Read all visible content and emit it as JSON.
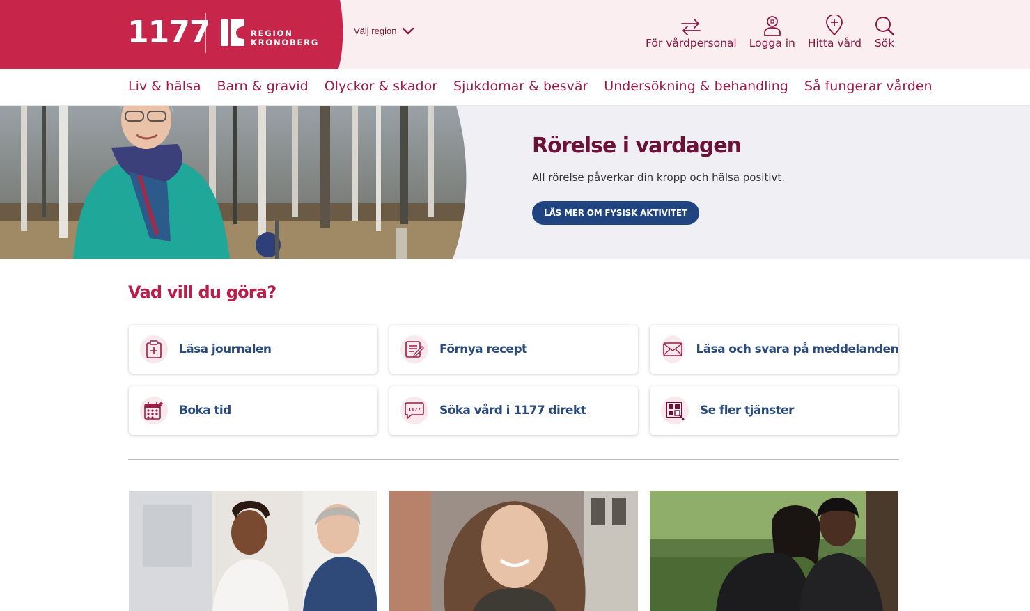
{
  "header": {
    "logo_text": "1177",
    "region_logo_text": [
      "REGION",
      "KRONOBERG"
    ],
    "region_select_label": "Välj region",
    "actions": [
      {
        "icon": "swap-arrows-icon",
        "label": "För vårdpersonal"
      },
      {
        "icon": "user-lock-icon",
        "label": "Logga in"
      },
      {
        "icon": "location-plus-icon",
        "label": "Hitta vård"
      },
      {
        "icon": "search-icon",
        "label": "Sök"
      }
    ]
  },
  "nav": {
    "items": [
      "Liv & hälsa",
      "Barn & gravid",
      "Olyckor & skador",
      "Sjukdomar & besvär",
      "Undersökning & behandling",
      "Så fungerar vården"
    ]
  },
  "hero": {
    "title": "Rörelse i vardagen",
    "text": "All rörelse påverkar din kropp och hälsa positivt.",
    "button": "LÄS MER OM FYSISK AKTIVITET"
  },
  "services": {
    "title": "Vad vill du göra?",
    "items": [
      {
        "icon": "medical-record-icon",
        "label": "Läsa journalen"
      },
      {
        "icon": "prescription-icon",
        "label": "Förnya recept"
      },
      {
        "icon": "envelope-icon",
        "label": "Läsa och svara på meddelanden"
      },
      {
        "icon": "calendar-icon",
        "label": "Boka tid"
      },
      {
        "icon": "chat-1177-icon",
        "label": "Söka vård i 1177 direkt"
      },
      {
        "icon": "grid-services-icon",
        "label": "Se fler tjänster"
      }
    ]
  },
  "colors": {
    "brand_red": "#c8254b",
    "header_bg": "#fbeef0",
    "nav_text": "#9b1b48",
    "hero_title": "#6b1236",
    "button_blue": "#1f4480",
    "card_text": "#2b4a7c"
  }
}
